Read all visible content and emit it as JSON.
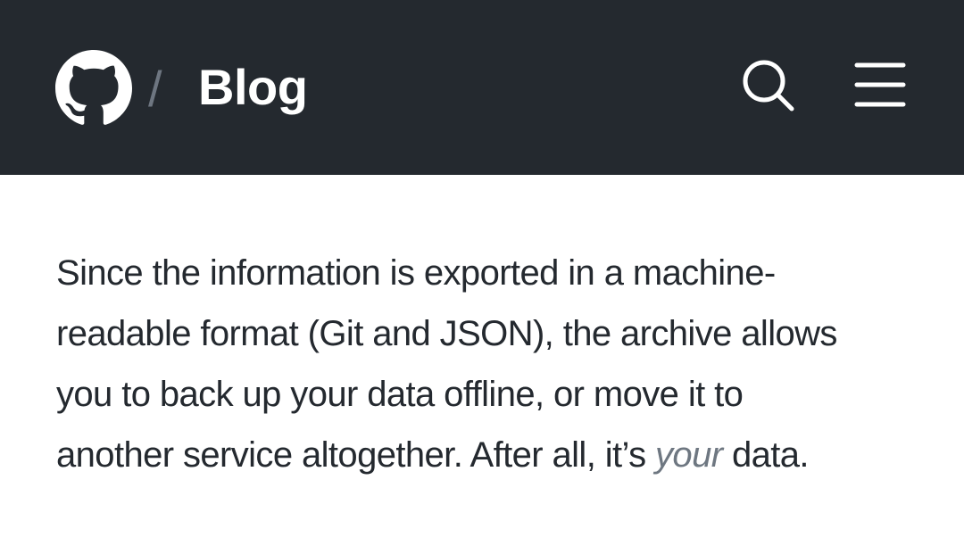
{
  "header": {
    "logo_icon": "github-mark-icon",
    "separator": "/",
    "title": "Blog",
    "search_icon": "search-icon",
    "menu_icon": "hamburger-menu-icon",
    "background_color": "#24292f"
  },
  "article": {
    "lines": [
      "Since the information is exported in a machine-",
      "readable format (Git and JSON), the archive allows",
      "you to back up your data offline, or move it to"
    ],
    "last_line_before": "another service altogether. After all, it’s ",
    "last_line_emphasis": "your",
    "last_line_after": " data.",
    "text_color": "#24292f",
    "emphasis_color": "#6e7781"
  }
}
